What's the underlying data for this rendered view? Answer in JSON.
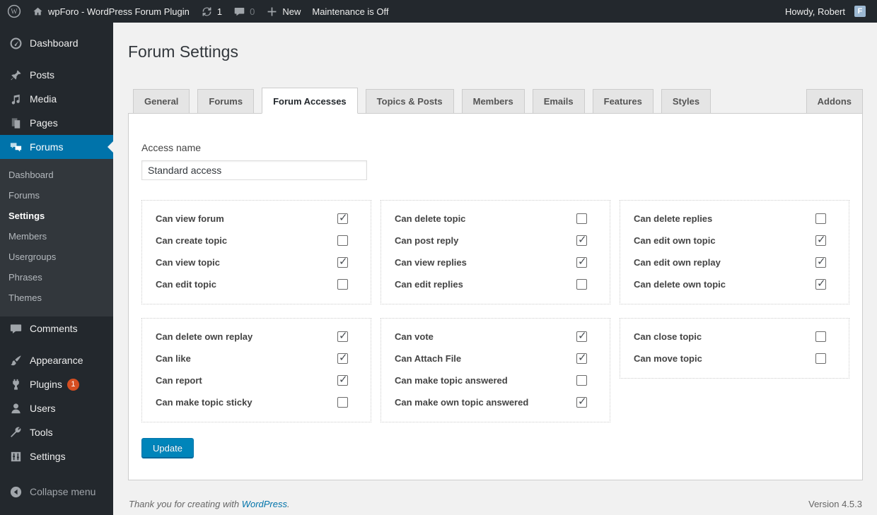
{
  "colors": {
    "accent": "#0073aa",
    "button_primary": "#0085ba",
    "badge": "#d54e21",
    "avatar_bg": "#9cb8d2"
  },
  "admin_bar": {
    "site_name": "wpForo - WordPress Forum Plugin",
    "update_count": "1",
    "comment_count": "0",
    "new_label": "New",
    "maintenance_label": "Maintenance is Off",
    "howdy": "Howdy, Robert",
    "avatar_letter": "F"
  },
  "sidebar": {
    "items": [
      {
        "label": "Dashboard",
        "icon": "dashboard-icon"
      },
      {
        "label": "Posts",
        "icon": "posts-icon",
        "gap_before": true
      },
      {
        "label": "Media",
        "icon": "media-icon"
      },
      {
        "label": "Pages",
        "icon": "pages-icon"
      },
      {
        "label": "Forums",
        "icon": "forums-icon",
        "active": true,
        "submenu": [
          "Dashboard",
          "Forums",
          "Settings",
          "Members",
          "Usergroups",
          "Phrases",
          "Themes"
        ]
      },
      {
        "label": "Comments",
        "icon": "comments-icon"
      },
      {
        "label": "Appearance",
        "icon": "appearance-icon",
        "gap_before": true
      },
      {
        "label": "Plugins",
        "icon": "plugins-icon",
        "badge": "1"
      },
      {
        "label": "Users",
        "icon": "users-icon"
      },
      {
        "label": "Tools",
        "icon": "tools-icon"
      },
      {
        "label": "Settings",
        "icon": "settings-icon"
      }
    ],
    "submenu_active": "Settings",
    "collapse_label": "Collapse menu"
  },
  "main": {
    "title": "Forum Settings",
    "tabs": [
      {
        "label": "General"
      },
      {
        "label": "Forums"
      },
      {
        "label": "Forum Accesses",
        "active": true
      },
      {
        "label": "Topics & Posts"
      },
      {
        "label": "Members"
      },
      {
        "label": "Emails"
      },
      {
        "label": "Features"
      },
      {
        "label": "Styles"
      },
      {
        "label": "Addons",
        "right": true
      }
    ],
    "access_name_label": "Access name",
    "access_name_value": "Standard access",
    "groups": [
      {
        "items": [
          {
            "label": "Can view forum",
            "checked": true
          },
          {
            "label": "Can create topic",
            "checked": false
          },
          {
            "label": "Can view topic",
            "checked": true
          },
          {
            "label": "Can edit topic",
            "checked": false
          }
        ]
      },
      {
        "items": [
          {
            "label": "Can delete topic",
            "checked": false
          },
          {
            "label": "Can post reply",
            "checked": true
          },
          {
            "label": "Can view replies",
            "checked": true
          },
          {
            "label": "Can edit replies",
            "checked": false
          }
        ]
      },
      {
        "items": [
          {
            "label": "Can delete replies",
            "checked": false
          },
          {
            "label": "Can edit own topic",
            "checked": true
          },
          {
            "label": "Can edit own replay",
            "checked": true
          },
          {
            "label": "Can delete own topic",
            "checked": true
          }
        ]
      },
      {
        "items": [
          {
            "label": "Can delete own replay",
            "checked": true
          },
          {
            "label": "Can like",
            "checked": true
          },
          {
            "label": "Can report",
            "checked": true
          },
          {
            "label": "Can make topic sticky",
            "checked": false
          }
        ]
      },
      {
        "items": [
          {
            "label": "Can vote",
            "checked": true
          },
          {
            "label": "Can Attach File",
            "checked": true
          },
          {
            "label": "Can make topic answered",
            "checked": false
          },
          {
            "label": "Can make own topic answered",
            "checked": true
          }
        ]
      },
      {
        "items": [
          {
            "label": "Can close topic",
            "checked": false
          },
          {
            "label": "Can move topic",
            "checked": false
          }
        ]
      }
    ],
    "update_label": "Update"
  },
  "footer": {
    "thanks_prefix": "Thank you for creating with",
    "thanks_link": "WordPress",
    "thanks_suffix": ".",
    "version": "Version 4.5.3"
  }
}
